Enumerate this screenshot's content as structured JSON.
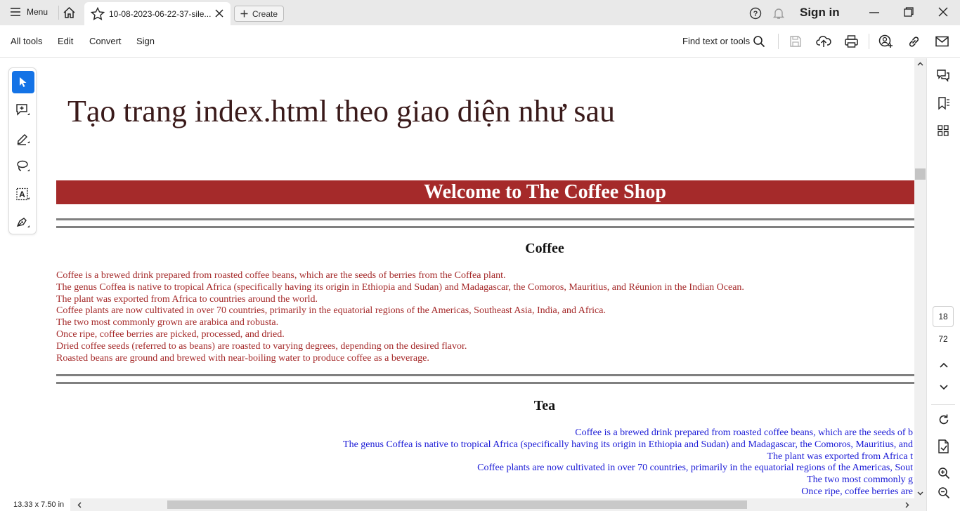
{
  "titlebar": {
    "menu_label": "Menu",
    "tab_title": "10-08-2023-06-22-37-sile...",
    "create_label": "Create",
    "signin_label": "Sign in"
  },
  "menubar": {
    "items": [
      "All tools",
      "Edit",
      "Convert",
      "Sign"
    ],
    "find_label": "Find text or tools"
  },
  "document": {
    "heading": "Tạo trang index.html theo giao diện như sau",
    "banner": "Welcome to The Coffee Shop",
    "coffee": {
      "title": "Coffee",
      "lines": [
        "Coffee is a brewed drink prepared from roasted coffee beans, which are the seeds of berries from the Coffea plant.",
        "The genus Coffea is native to tropical Africa (specifically having its origin in Ethiopia and Sudan) and Madagascar, the Comoros, Mauritius, and Réunion in the Indian Ocean.",
        "The plant was exported from Africa to countries around the world.",
        "Coffee plants are now cultivated in over 70 countries, primarily in the equatorial regions of the Americas, Southeast Asia, India, and Africa.",
        "The two most commonly grown are arabica and robusta.",
        "Once ripe, coffee berries are picked, processed, and dried.",
        "Dried coffee seeds (referred to as beans) are roasted to varying degrees, depending on the desired flavor.",
        "Roasted beans are ground and brewed with near-boiling water to produce coffee as a beverage."
      ],
      "color": "#a52a2a"
    },
    "tea": {
      "title": "Tea",
      "lines": [
        "Coffee is a brewed drink prepared from roasted coffee beans, which are the seeds of b",
        "The genus Coffea is native to tropical Africa (specifically having its origin in Ethiopia and Sudan) and Madagascar, the Comoros, Mauritius, and",
        "The plant was exported from Africa t",
        "Coffee plants are now cultivated in over 70 countries, primarily in the equatorial regions of the Americas, Sout",
        "The two most commonly g",
        "Once ripe, coffee berries are"
      ],
      "color": "#1a1ad6"
    },
    "banner_color": "#a52a2a"
  },
  "statusbar": {
    "page_size": "13.33 x 7.50 in"
  },
  "pagination": {
    "current_page": "18",
    "total_pages": "72"
  },
  "icons": {
    "titlebar": [
      "menu-icon",
      "home-icon",
      "star-icon",
      "close-tab-icon",
      "plus-icon",
      "help-icon",
      "bell-icon",
      "minimize-icon",
      "restore-icon",
      "close-window-icon"
    ],
    "menubar": [
      "search-icon",
      "save-icon",
      "upload-icon",
      "print-icon",
      "share-user-icon",
      "link-icon",
      "mail-icon"
    ],
    "tools": [
      "select-cursor-icon",
      "add-comment-icon",
      "highlight-pen-icon",
      "lasso-icon",
      "text-select-icon",
      "sign-pen-icon"
    ],
    "right_rail": [
      "comments-icon",
      "bookmark-icon",
      "thumbnails-icon",
      "chevron-up-icon",
      "chevron-down-icon",
      "rotate-icon",
      "extract-page-icon",
      "zoom-in-icon",
      "zoom-out-icon"
    ]
  }
}
